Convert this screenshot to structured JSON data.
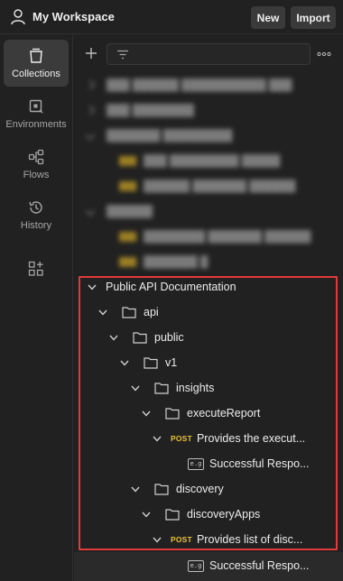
{
  "header": {
    "workspace_title": "My Workspace",
    "new_label": "New",
    "import_label": "Import"
  },
  "rail": {
    "items": [
      {
        "label": "Collections",
        "icon": "collections-icon",
        "active": true
      },
      {
        "label": "Environments",
        "icon": "environments-icon"
      },
      {
        "label": "Flows",
        "icon": "flows-icon"
      },
      {
        "label": "History",
        "icon": "history-icon"
      },
      {
        "label": "",
        "icon": "add-workspace-item-icon"
      }
    ]
  },
  "tree": {
    "collection": "Public API Documentation",
    "api": "api",
    "public": "public",
    "v1": "v1",
    "insights": "insights",
    "executeReport": "executeReport",
    "req1_method": "POST",
    "req1_label": "Provides the execut...",
    "example1": "Successful Respo...",
    "discovery": "discovery",
    "discoveryApps": "discoveryApps",
    "req2_method": "POST",
    "req2_label": "Provides list of disc...",
    "example2": "Successful Respo...",
    "example_icon_text": "e.g"
  },
  "colors": {
    "highlight": "#e03a3a",
    "post": "#e8c23a"
  }
}
